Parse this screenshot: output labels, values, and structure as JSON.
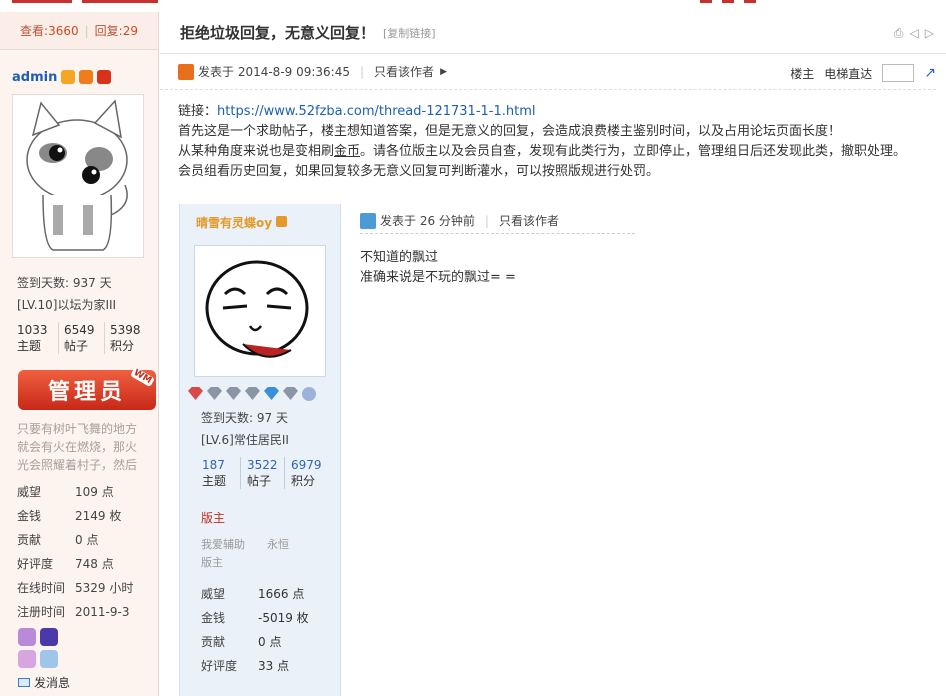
{
  "header": {
    "title": "拒绝垃圾回复，无意义回复！",
    "copy_link": "[复制链接]"
  },
  "thread_stats": {
    "views_label": "查看:",
    "views": "3660",
    "replies_label": "回复:",
    "replies": "29"
  },
  "op": {
    "username": "admin",
    "checkin": "签到天数: 937 天",
    "level": "[LV.10]以坛为家III",
    "counts": [
      {
        "value": "1033",
        "label": "主题"
      },
      {
        "value": "6549",
        "label": "帖子"
      },
      {
        "value": "5398",
        "label": "积分"
      }
    ],
    "role_button": "管理员",
    "role_tag": "WM",
    "signature": "只要有树叶飞舞的地方就会有火在燃烧，那火光会照耀着村子，然后",
    "fields": [
      {
        "k": "威望",
        "v": "109 点"
      },
      {
        "k": "金钱",
        "v": "2149 枚"
      },
      {
        "k": "贡献",
        "v": "0 点"
      },
      {
        "k": "好评度",
        "v": "748 点"
      },
      {
        "k": "在线时间",
        "v": "5329 小时"
      },
      {
        "k": "注册时间",
        "v": "2011-9-3"
      }
    ],
    "send_message": "发消息"
  },
  "post": {
    "posted": "发表于 2014-8-9 09:36:45",
    "only_author": "只看该作者",
    "floor_label": "楼主",
    "jump_label": "电梯直达",
    "link_label": "链接：",
    "link": "https://www.52fzba.com/thread-121731-1-1.html",
    "line1": "首先这是一个求助帖子，楼主想知道答案，但是无意义的回复，会造成浪费楼主鉴别时间，以及占用论坛页面长度！",
    "line2a": "从某种角度来说也是变相刷",
    "line2_gold": "金币",
    "line2b": "。请各位版主以及会员自查，发现有此类行为，立即停止，管理组日后还发现此类，撤职处理。",
    "line3": "会员组看历史回复，如果回复较多无意义回复可判断灌水，可以按照版规进行处罚。"
  },
  "reply": {
    "username": "晴雪有灵蝶oy",
    "checkin": "签到天数: 97 天",
    "level": "[LV.6]常住居民II",
    "counts": [
      {
        "value": "187",
        "label": "主题"
      },
      {
        "value": "3522",
        "label": "帖子"
      },
      {
        "value": "6979",
        "label": "积分"
      }
    ],
    "role": "版主",
    "groups": "我爱辅助　　永恒　　版主",
    "fields": [
      {
        "k": "威望",
        "v": "1666 点"
      },
      {
        "k": "金钱",
        "v": "-5019 枚"
      },
      {
        "k": "贡献",
        "v": "0 点"
      },
      {
        "k": "好评度",
        "v": "33 点"
      }
    ],
    "posted": "发表于 26 分钟前",
    "only_author": "只看该作者",
    "body1": "不知道的飘过",
    "body2": "准确来说是不玩的飘过= ="
  },
  "colors": {
    "accent": "#c8302b",
    "link": "#1d5fb0",
    "reply_bg": "#eaf1f8"
  }
}
